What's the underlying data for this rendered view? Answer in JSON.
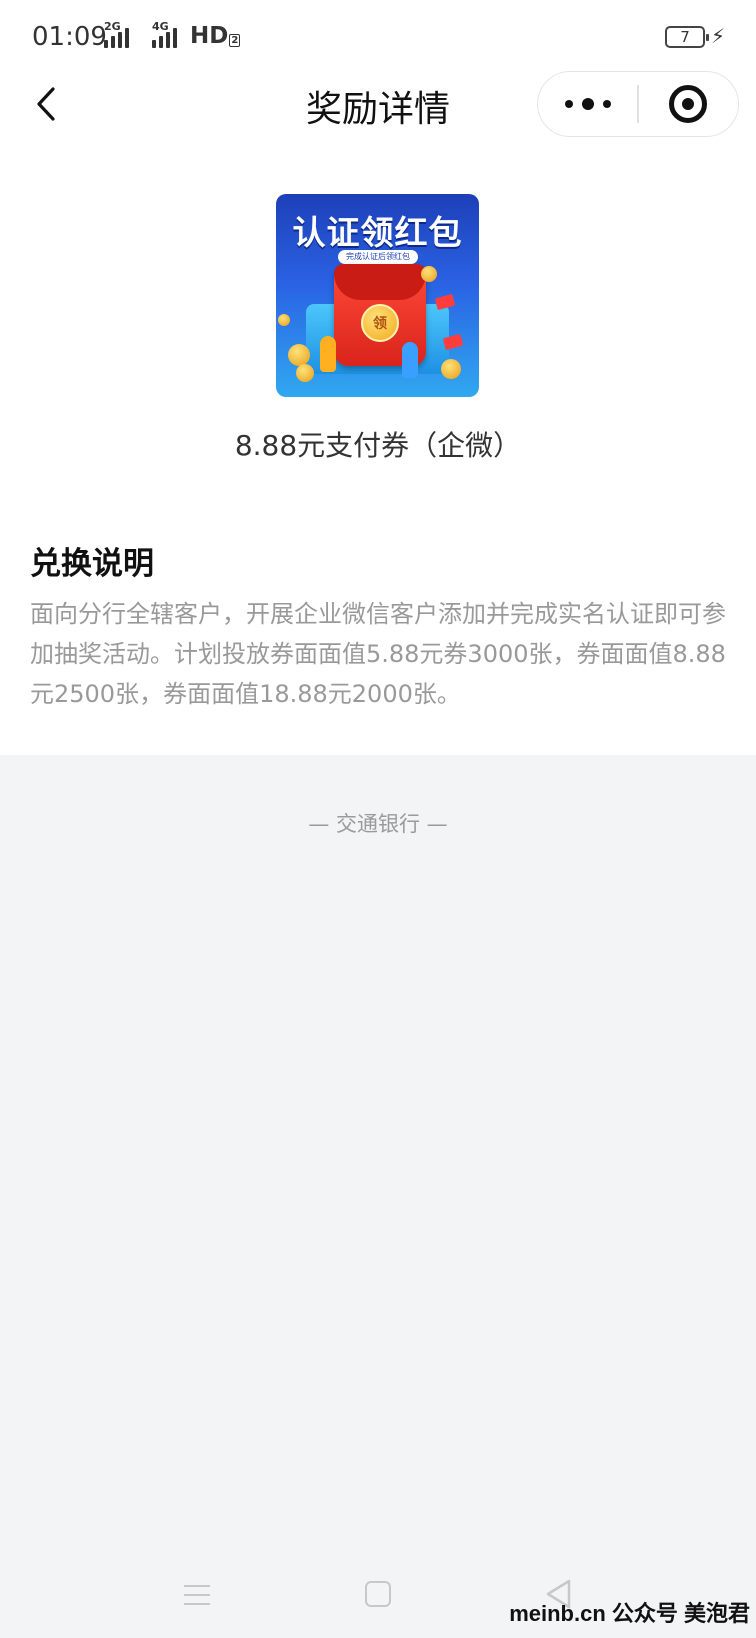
{
  "status_bar": {
    "time": "01:09",
    "network_1": "2G",
    "network_2": "4G",
    "hd": "HD",
    "hd_sub": "2",
    "battery": "7"
  },
  "nav": {
    "title": "奖励详情"
  },
  "reward": {
    "banner_title": "认证领红包",
    "banner_subtitle": "完成认证后领红包",
    "coin_text": "领",
    "name": "8.88元支付券（企微）"
  },
  "section": {
    "title": "兑换说明",
    "body": "面向分行全辖客户，开展企业微信客户添加并完成实名认证即可参加抽奖活动。计划投放券面面值5.88元券3000张，券面面值8.88元2500张，券面面值18.88元2000张。"
  },
  "footer": {
    "brand": "— 交通银行 —"
  },
  "watermark": "meinb.cn  公众号 美泡君",
  "icons": {
    "back": "chevron-left-icon",
    "more": "more-dots-icon",
    "close": "target-close-icon",
    "menu": "menu-lines-icon",
    "home": "square-home-icon",
    "sys_back": "triangle-back-icon"
  }
}
